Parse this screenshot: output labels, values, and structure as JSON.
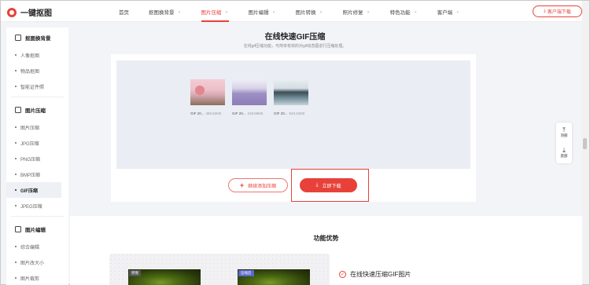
{
  "app": {
    "name": "一键抠图"
  },
  "nav": [
    {
      "label": "首页",
      "dropdown": false,
      "active": false
    },
    {
      "label": "抠图换背景",
      "dropdown": true,
      "active": false
    },
    {
      "label": "图片压缩",
      "dropdown": true,
      "active": true
    },
    {
      "label": "图片编辑",
      "dropdown": true,
      "active": false
    },
    {
      "label": "图片转换",
      "dropdown": true,
      "active": false
    },
    {
      "label": "照片修复",
      "dropdown": true,
      "active": false
    },
    {
      "label": "特色功能",
      "dropdown": true,
      "active": false
    },
    {
      "label": "客户端",
      "dropdown": true,
      "active": false
    }
  ],
  "header_download": "客户端下载",
  "sidebar": [
    {
      "title": "抠图换背景",
      "items": [
        "人像抠图",
        "物品抠图",
        "智能证件照"
      ]
    },
    {
      "title": "图片压缩",
      "items": [
        "图片压缩",
        "JPG压缩",
        "PNG压缩",
        "BMP压缩",
        "GIF压缩",
        "JPEG压缩"
      ]
    },
    {
      "title": "图片编辑",
      "items": [
        "综合编辑",
        "图片改大小",
        "图片裁剪"
      ]
    }
  ],
  "sidebar_active": "GIF压缩",
  "main": {
    "title": "在线快速GIF压缩",
    "subtitle": "在线gif压缩功能，可简单有效的对gif动态图进行压缩处理。",
    "files": [
      {
        "name": "GIF 20...",
        "size": "455.52KB"
      },
      {
        "name": "GIF 20...",
        "size": "418.69KB"
      },
      {
        "name": "GIF 20...",
        "size": "543.34KB"
      }
    ],
    "add_button": "继续添加压缩",
    "download_button": "立即下载"
  },
  "float": {
    "top": "顶部",
    "bottom": "底部"
  },
  "advantages": {
    "title": "功能优势",
    "label_original": "原图",
    "label_compressed": "压缩后",
    "feature": "在线快速压缩GIF图片"
  },
  "colors": {
    "accent": "#e8413a",
    "background": "#f3f4f8"
  }
}
